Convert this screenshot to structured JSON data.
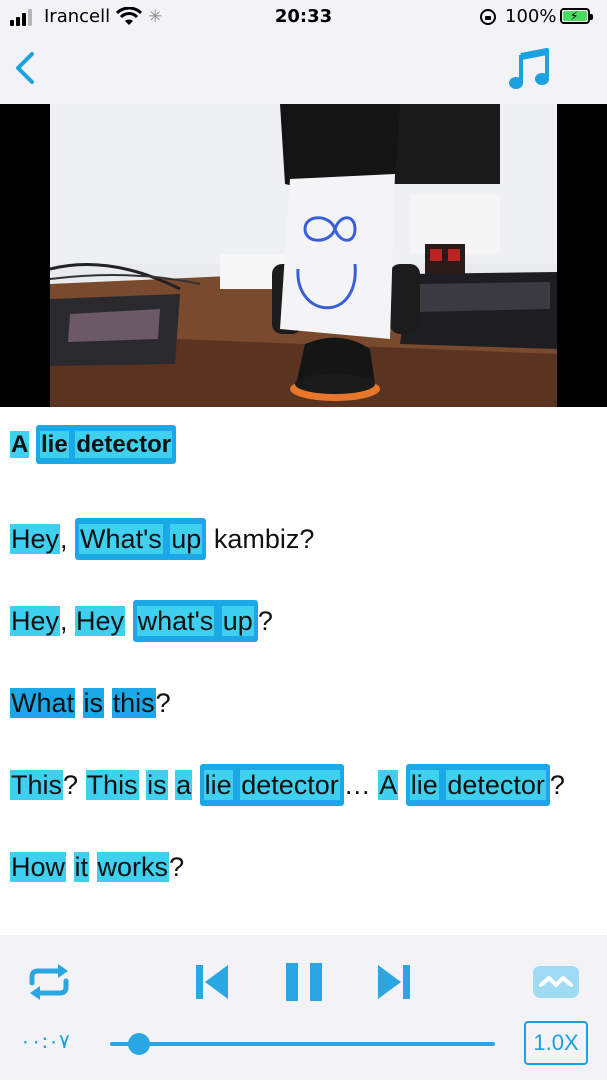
{
  "status_bar": {
    "carrier": "Irancell",
    "time": "20:33",
    "battery": "100%"
  },
  "player": {
    "elapsed": "۰۰:۰۷",
    "speed": "1.0X",
    "progress": 0.07,
    "is_playing": true
  },
  "colors": {
    "accent": "#1ca7e6",
    "highlight": "#3fd0f0",
    "bar_background": "#f2f2f7"
  },
  "icons": [
    "back-icon",
    "music-note-icon",
    "repeat-icon",
    "previous-icon",
    "pause-icon",
    "next-icon",
    "subtitle-icon"
  ],
  "transcript": {
    "l1": {
      "t1": "A",
      "t2": "lie",
      "t3": "detector"
    },
    "l2": {
      "t1": "Hey",
      "t2": ",",
      "t3": "What's",
      "t4": "up",
      "t5": "kambiz?"
    },
    "l3": {
      "t1": "Hey",
      "t2": ",",
      "t3": "Hey",
      "t4": "what's",
      "t5": "up",
      "t6": "?"
    },
    "l4": {
      "t1": "What",
      "t2": "is",
      "t3": "this",
      "t4": "?"
    },
    "l5": {
      "t1": "This",
      "t2": "?",
      "t3": "This",
      "t4": "is",
      "t5": "a",
      "t6": "lie",
      "t7": "detector",
      "t8": "… ",
      "t9": "A",
      "t10": "lie",
      "t11": "detector",
      "t12": "?"
    },
    "l6": {
      "t1": "How",
      "t2": "it",
      "t3": "works",
      "t4": "?"
    }
  }
}
